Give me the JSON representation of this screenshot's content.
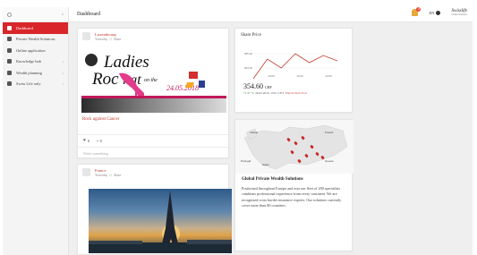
{
  "header": {
    "title": "Dashboard",
    "notifications_count": "3",
    "language": "EN",
    "logo_line1": "Swisslife",
    "logo_line2": "Global Solutions"
  },
  "sidebar": {
    "items": [
      {
        "label": "Dashboard",
        "active": true,
        "has_submenu": false
      },
      {
        "label": "Private Wealth Solutions",
        "active": false,
        "has_submenu": false
      },
      {
        "label": "Online application",
        "active": false,
        "has_submenu": false
      },
      {
        "label": "Knowledge hub",
        "active": false,
        "has_submenu": true
      },
      {
        "label": "Wealth planning",
        "active": false,
        "has_submenu": true
      },
      {
        "label": "Swiss Life only",
        "active": false,
        "has_submenu": true
      }
    ]
  },
  "feed": [
    {
      "author": "Luxembourg",
      "date": "Yesterday",
      "share_label": "Share",
      "banner": {
        "line1": "Ladies",
        "line2": "Roc",
        "subtitle": "on the",
        "word": "hat",
        "date": "24.05.2018"
      },
      "caption": "Rock against Cancer",
      "likes": "0",
      "comments": "0",
      "comment_placeholder": "Write something"
    },
    {
      "author": "France",
      "date": "Yesterday",
      "share_label": "Share"
    }
  ],
  "share_price": {
    "title": "Share Price",
    "price": "354.60",
    "currency": "CHF",
    "change": "+1.27 %",
    "date_time": "26.02.2019, 15:01 CET",
    "link": "Watch Chart Tool",
    "y_ticks": [
      "355.00",
      "354.00"
    ],
    "x_ticks": [
      "10:00",
      "12:00",
      "14:00"
    ]
  },
  "chart_data": {
    "type": "line",
    "x": [
      "10:00",
      "12:00",
      "14:00"
    ],
    "series": [
      {
        "values": [
          353.6,
          354.7,
          354.2,
          355.0,
          354.5,
          354.9,
          354.6
        ]
      }
    ],
    "ylim": [
      354,
      355.5
    ],
    "xlabel": "",
    "ylabel": ""
  },
  "global": {
    "title": "Global Private Wealth Solutions",
    "text": "Positioned throughout Europe and asia our fleet of 200 specialists combines professional experience from every continent. We are recognized cross border insurance experts. Our solutions currently cover more than 80 countries.",
    "map_labels": [
      "Ireland",
      "Poland",
      "Portugal",
      "Greece",
      "Spain"
    ]
  }
}
